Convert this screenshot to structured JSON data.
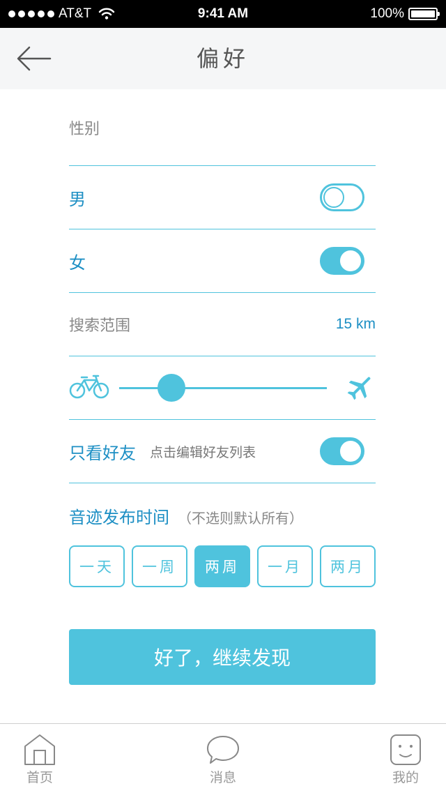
{
  "status_bar": {
    "carrier": "AT&T",
    "time": "9:41 AM",
    "battery": "100%"
  },
  "nav": {
    "title": "偏好",
    "back_icon": "arrow-left-icon"
  },
  "gender": {
    "header": "性别",
    "options": [
      {
        "label": "男",
        "on": false
      },
      {
        "label": "女",
        "on": true
      }
    ]
  },
  "search_range": {
    "label": "搜索范围",
    "value": "15 km",
    "slider_fraction": 0.25,
    "min_icon": "bicycle-icon",
    "max_icon": "airplane-icon"
  },
  "friends_only": {
    "label": "只看好友",
    "hint": "点击编辑好友列表",
    "on": true
  },
  "post_time": {
    "title": "音迹发布时间",
    "subtitle": "（不选则默认所有）",
    "options": [
      "一天",
      "一周",
      "两周",
      "一月",
      "两月"
    ],
    "selected_index": 2
  },
  "cta": {
    "label": "好了，继续发现"
  },
  "tab_bar": {
    "items": [
      {
        "label": "首页",
        "icon": "home-icon"
      },
      {
        "label": "消息",
        "icon": "chat-bubble-icon"
      },
      {
        "label": "我的",
        "icon": "face-icon"
      }
    ]
  },
  "colors": {
    "accent": "#4fc3dd",
    "accent_text": "#1d8fc4"
  }
}
